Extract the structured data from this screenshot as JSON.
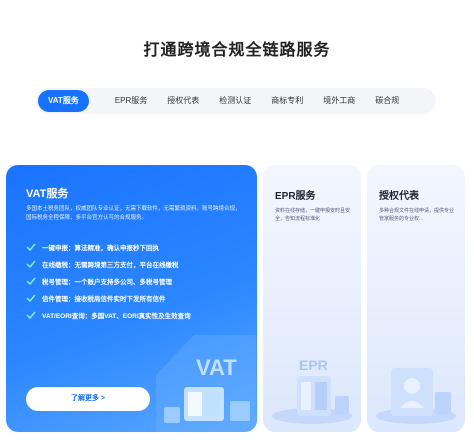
{
  "page": {
    "title": "打通跨境合规全链路服务"
  },
  "tabs": [
    {
      "label": "VAT服务",
      "active": true
    },
    {
      "label": "EPR服务",
      "active": false
    },
    {
      "label": "授权代表",
      "active": false
    },
    {
      "label": "检测认证",
      "active": false
    },
    {
      "label": "商标专利",
      "active": false
    },
    {
      "label": "境外工商",
      "active": false
    },
    {
      "label": "碳合规",
      "active": false
    }
  ],
  "vat_card": {
    "title": "VAT服务",
    "description": "多国本土税务团队，权威团队专业认证，无需下载软件，无需繁琐资料，账号跨境合规，国际税务全程保障，多平台官方认可的合规服务。",
    "features": [
      "一键申报：算法精准，确认申报秒下回执",
      "在线缴税：无需跨境第三方支付，平台在线缴税",
      "税号管理：一个账户支持多公司、多税号管理",
      "信件管理：接收税局信件实时下发所有信件",
      "VAT/EORI查询：多国VAT、EORI真实性及生效查询"
    ],
    "button_label": "了解更多 >",
    "illustration_text": "VAT",
    "colors": {
      "accent": "#1671ff"
    }
  },
  "epr_card": {
    "title": "EPR服务",
    "description": "资料在线存储，一键申报安时且安全，告知流程标准化",
    "illustration_text": "EPR"
  },
  "auth_card": {
    "title": "授权代表",
    "description": "多种合规文件在线申请，提供专业管家服务的专业权..."
  }
}
